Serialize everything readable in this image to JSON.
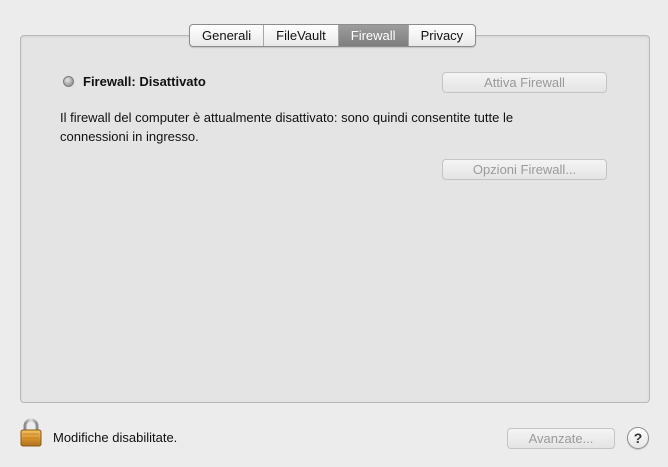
{
  "tabs": [
    {
      "label": "Generali",
      "active": false
    },
    {
      "label": "FileVault",
      "active": false
    },
    {
      "label": "Firewall",
      "active": true
    },
    {
      "label": "Privacy",
      "active": false
    }
  ],
  "firewall": {
    "status_label": "Firewall: Disattivato",
    "status_icon": "status-dot-gray",
    "description": "Il firewall del computer è attualmente disattivato: sono quindi consentite tutte le connessioni in ingresso.",
    "activate_button": "Attiva Firewall",
    "options_button": "Opzioni Firewall..."
  },
  "footer": {
    "lock_icon": "lock-icon",
    "lock_text": "Modifiche disabilitate.",
    "advanced_button": "Avanzate...",
    "help_label": "?"
  },
  "colors": {
    "active_tab": "#8a8a8a",
    "disabled_text": "#9a9a9a",
    "background": "#ececec"
  }
}
